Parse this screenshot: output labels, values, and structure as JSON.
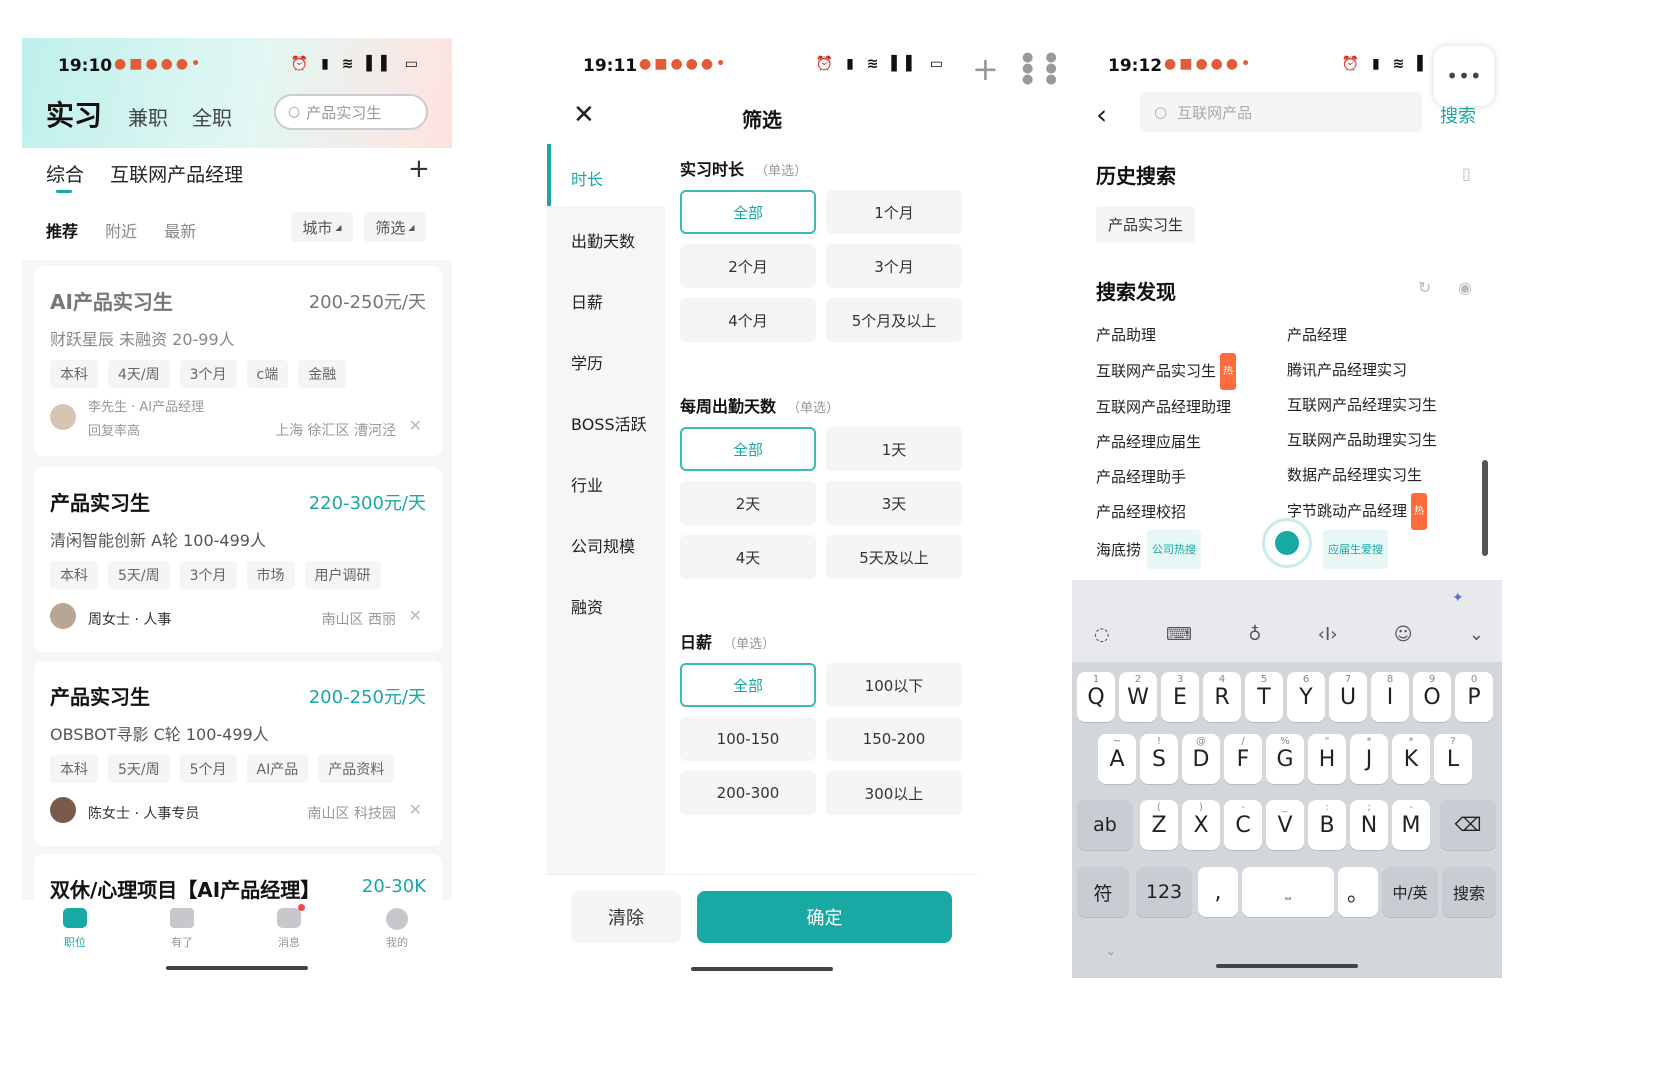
{
  "panel1": {
    "status": {
      "time": "19:10"
    },
    "top_tabs": [
      "实习",
      "兼职",
      "全职"
    ],
    "search_placeholder": "产品实习生",
    "category_tabs": [
      "综合",
      "互联网产品经理"
    ],
    "add_symbol": "+",
    "sort_tabs": [
      "推荐",
      "附近",
      "最新"
    ],
    "filters": [
      "城市",
      "筛选"
    ],
    "jobs": [
      {
        "title": "AI产品实习生",
        "salary": "200-250元/天",
        "company": "财跃星辰 未融资 20-99人",
        "tags": [
          "本科",
          "4天/周",
          "3个月",
          "c端",
          "金融"
        ],
        "recruiter": "李先生 · AI产品经理",
        "note": "回复率高",
        "location": "上海 徐汇区 漕河泾"
      },
      {
        "title": "产品实习生",
        "salary": "220-300元/天",
        "company": "清闲智能创新 A轮 100-499人",
        "tags": [
          "本科",
          "5天/周",
          "3个月",
          "市场",
          "用户调研"
        ],
        "recruiter": "周女士 · 人事",
        "location": "南山区 西丽"
      },
      {
        "title": "产品实习生",
        "salary": "200-250元/天",
        "company": "OBSBOT寻影 C轮 100-499人",
        "tags": [
          "本科",
          "5天/周",
          "5个月",
          "AI产品",
          "产品资料"
        ],
        "recruiter": "陈女士 · 人事专员",
        "location": "南山区 科技园"
      },
      {
        "title": "双休/心理项目【AI产品经理】",
        "salary": "20-30K"
      }
    ],
    "nav": [
      "职位",
      "有了",
      "消息",
      "我的"
    ]
  },
  "panel2": {
    "status": {
      "time": "19:11"
    },
    "title": "筛选",
    "sidebar": [
      "时长",
      "出勤天数",
      "日薪",
      "学历",
      "BOSS活跃",
      "行业",
      "公司规模",
      "融资"
    ],
    "sections": [
      {
        "title": "实习时长",
        "hint": "（单选）",
        "options": [
          "全部",
          "1个月",
          "2个月",
          "3个月",
          "4个月",
          "5个月及以上"
        ]
      },
      {
        "title": "每周出勤天数",
        "hint": "（单选）",
        "options": [
          "全部",
          "1天",
          "2天",
          "3天",
          "4天",
          "5天及以上"
        ]
      },
      {
        "title": "日薪",
        "hint": "（单选）",
        "options": [
          "全部",
          "100以下",
          "100-150",
          "150-200",
          "200-300",
          "300以上"
        ]
      }
    ],
    "clear_label": "清除",
    "confirm_label": "确定"
  },
  "panel3": {
    "status": {
      "time": "19:12"
    },
    "search_placeholder": "互联网产品",
    "search_label": "搜索",
    "history_title": "历史搜索",
    "history_items": [
      "产品实习生"
    ],
    "discover_title": "搜索发现",
    "discover_left": [
      {
        "t": "产品助理"
      },
      {
        "t": "互联网产品实习生",
        "hot": "热"
      },
      {
        "t": "互联网产品经理助理"
      },
      {
        "t": "产品经理应届生"
      },
      {
        "t": "产品经理助手"
      },
      {
        "t": "产品经理校招"
      },
      {
        "t": "海底捞",
        "label": "公司热搜"
      }
    ],
    "discover_right": [
      {
        "t": "产品经理"
      },
      {
        "t": "腾讯产品经理实习"
      },
      {
        "t": "互联网产品经理实习生"
      },
      {
        "t": "互联网产品助理实习生"
      },
      {
        "t": "数据产品经理实习生"
      },
      {
        "t": "字节跳动产品经理",
        "hot": "热"
      },
      {
        "t": "",
        "label": "应届生爱搜"
      }
    ],
    "keys_row1": [
      {
        "k": "Q",
        "s": "1"
      },
      {
        "k": "W",
        "s": "2"
      },
      {
        "k": "E",
        "s": "3"
      },
      {
        "k": "R",
        "s": "4"
      },
      {
        "k": "T",
        "s": "5"
      },
      {
        "k": "Y",
        "s": "6"
      },
      {
        "k": "U",
        "s": "7"
      },
      {
        "k": "I",
        "s": "8"
      },
      {
        "k": "O",
        "s": "9"
      },
      {
        "k": "P",
        "s": "0"
      }
    ],
    "keys_row2": [
      {
        "k": "A",
        "s": "~"
      },
      {
        "k": "S",
        "s": "!"
      },
      {
        "k": "D",
        "s": "@"
      },
      {
        "k": "F",
        "s": "/"
      },
      {
        "k": "G",
        "s": "%"
      },
      {
        "k": "H",
        "s": "\""
      },
      {
        "k": "J",
        "s": "*"
      },
      {
        "k": "K",
        "s": "*"
      },
      {
        "k": "L",
        "s": "?"
      }
    ],
    "keys_row3": [
      {
        "k": "Z",
        "s": "("
      },
      {
        "k": "X",
        "s": ")"
      },
      {
        "k": "C",
        "s": "-"
      },
      {
        "k": "V",
        "s": "_"
      },
      {
        "k": "B",
        "s": ":"
      },
      {
        "k": "N",
        "s": ";"
      },
      {
        "k": "M",
        "s": "-"
      }
    ],
    "key_ab": "ab",
    "key_sym": "符",
    "key_123": "123",
    "key_comma": ",",
    "key_dot": "。",
    "key_lang": "中/英",
    "key_search": "搜索"
  }
}
